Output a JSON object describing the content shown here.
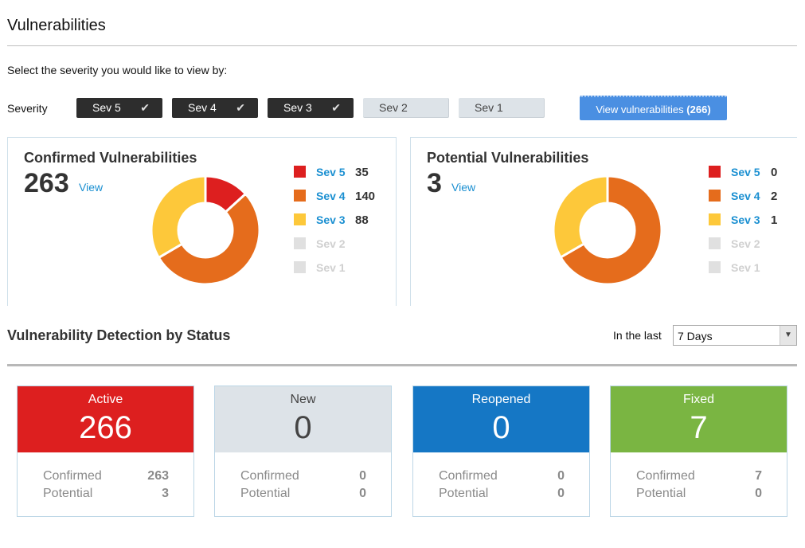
{
  "page": {
    "title": "Vulnerabilities",
    "prompt": "Select the severity you would like to view by:",
    "severity_label": "Severity"
  },
  "severity_filters": [
    {
      "label": "Sev 5",
      "selected": true
    },
    {
      "label": "Sev 4",
      "selected": true
    },
    {
      "label": "Sev 3",
      "selected": true
    },
    {
      "label": "Sev 2",
      "selected": false
    },
    {
      "label": "Sev 1",
      "selected": false
    }
  ],
  "view_button": {
    "label": "View vulnerabilities",
    "count": "(266)"
  },
  "colors": {
    "sev5": "#dd1f1f",
    "sev4": "#e56c1c",
    "sev3": "#fdc83a",
    "disabled": "#e0e0e0",
    "link": "#1a8fd1",
    "active": "#dd1f1f",
    "new": "#dde3e8",
    "reopened": "#1577c5",
    "fixed": "#7ab542"
  },
  "confirmed": {
    "title": "Confirmed Vulnerabilities",
    "total": "263",
    "view_label": "View",
    "legend": [
      {
        "name": "Sev 5",
        "value": 35,
        "enabled": true
      },
      {
        "name": "Sev 4",
        "value": 140,
        "enabled": true
      },
      {
        "name": "Sev 3",
        "value": 88,
        "enabled": true
      },
      {
        "name": "Sev 2",
        "value": null,
        "enabled": false
      },
      {
        "name": "Sev 1",
        "value": null,
        "enabled": false
      }
    ]
  },
  "potential": {
    "title": "Potential Vulnerabilities",
    "total": "3",
    "view_label": "View",
    "legend": [
      {
        "name": "Sev 5",
        "value": 0,
        "enabled": true
      },
      {
        "name": "Sev 4",
        "value": 2,
        "enabled": true
      },
      {
        "name": "Sev 3",
        "value": 1,
        "enabled": true
      },
      {
        "name": "Sev 2",
        "value": null,
        "enabled": false
      },
      {
        "name": "Sev 1",
        "value": null,
        "enabled": false
      }
    ]
  },
  "status": {
    "title": "Vulnerability Detection by Status",
    "in_the_last_label": "In the last",
    "period": "7 Days",
    "tiles": [
      {
        "label": "Active",
        "total": "266",
        "confirmed_label": "Confirmed",
        "confirmed": "263",
        "potential_label": "Potential",
        "potential": "3"
      },
      {
        "label": "New",
        "total": "0",
        "confirmed_label": "Confirmed",
        "confirmed": "0",
        "potential_label": "Potential",
        "potential": "0"
      },
      {
        "label": "Reopened",
        "total": "0",
        "confirmed_label": "Confirmed",
        "confirmed": "0",
        "potential_label": "Potential",
        "potential": "0"
      },
      {
        "label": "Fixed",
        "total": "7",
        "confirmed_label": "Confirmed",
        "confirmed": "7",
        "potential_label": "Potential",
        "potential": "0"
      }
    ]
  }
}
